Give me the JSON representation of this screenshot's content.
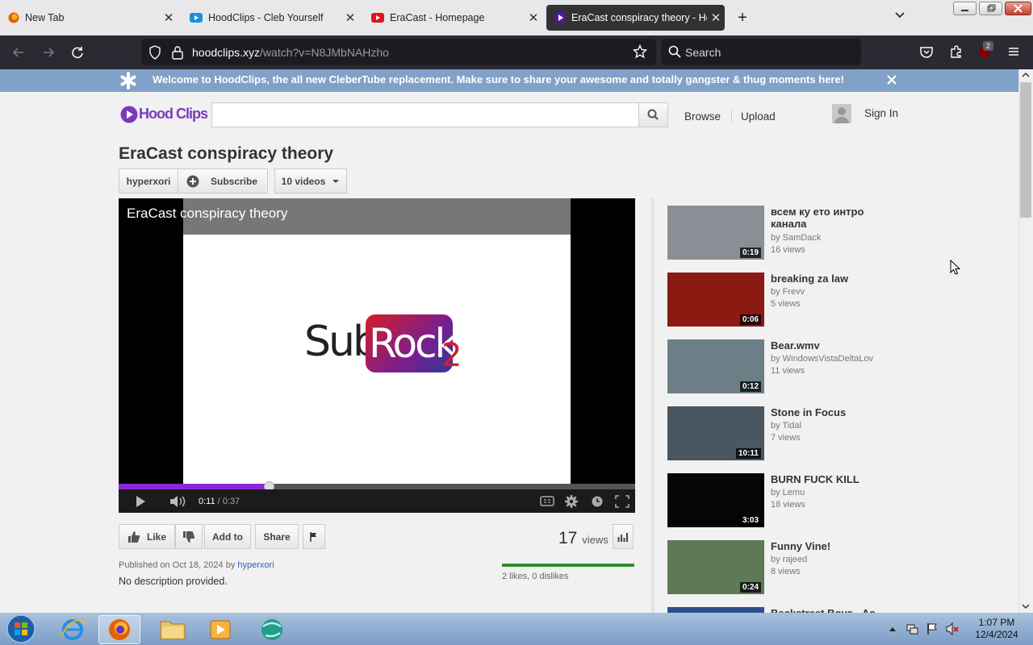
{
  "browser": {
    "tabs": [
      {
        "title": "New Tab",
        "icon": "firefox-icon",
        "active": false
      },
      {
        "title": "HoodClips - Cleb Yourself",
        "icon": "hoodclips-favicon",
        "active": false
      },
      {
        "title": "EraCast - Homepage",
        "icon": "eracast-favicon",
        "active": false
      },
      {
        "title": "EraCast conspiracy theory - Hoo",
        "icon": "hoodclips-play-favicon",
        "active": true
      }
    ],
    "url_host": "hoodclips.xyz",
    "url_path": "/watch?v=N8JMbNAHzho",
    "search_placeholder": "Search",
    "extension_badge": "2"
  },
  "banner": {
    "text": "Welcome to HoodClips, the all new CleberTube replacement. Make sure to share your awesome and totally gangster & thug moments here!"
  },
  "site": {
    "logo_text": "Hood Clips",
    "nav": {
      "browse": "Browse",
      "upload": "Upload",
      "signin": "Sign In"
    }
  },
  "video": {
    "title": "EraCast conspiracy theory",
    "channel": "hyperxori",
    "subscribe_label": "Subscribe",
    "videos_label": "10 videos",
    "overlay_title": "EraCast conspiracy theory",
    "current_time": "0:11",
    "total_time": "/ 0:37",
    "progress": 0.29,
    "logo_sub": "Sub",
    "logo_rock": "Rock",
    "logo_two": "2",
    "actions": {
      "like": "Like",
      "add_to": "Add to",
      "share": "Share"
    },
    "views_count": "17",
    "views_label": "views",
    "likes_text": "2 likes, 0 dislikes",
    "published_prefix": "Published on Oct 18, 2024 by",
    "published_by": "hyperxori",
    "description": "No description provided."
  },
  "sidebar": [
    {
      "title": "всем ку ето интро канала",
      "by": "by SamDack",
      "views": "16 views",
      "duration": "0:19",
      "color": "#8a8f96"
    },
    {
      "title": "breaking za law",
      "by": "by Frevv",
      "views": "5 views",
      "duration": "0:06",
      "color": "#8a1a12"
    },
    {
      "title": "Bear.wmv",
      "by": "by WindowsVistaDeltaLov",
      "views": "11 views",
      "duration": "0:12",
      "color": "#6c7f86"
    },
    {
      "title": "Stone in Focus",
      "by": "by Tidal",
      "views": "7 views",
      "duration": "10:11",
      "color": "#4a5660"
    },
    {
      "title": "BURN FUCK KILL",
      "by": "by Lemu",
      "views": "18 views",
      "duration": "3:03",
      "color": "#050505"
    },
    {
      "title": "Funny Vine!",
      "by": "by rajeed",
      "views": "8 views",
      "duration": "0:24",
      "color": "#5d7a55"
    },
    {
      "title": "Backstreet Boys - As",
      "by": "",
      "views": "",
      "duration": "",
      "color": "#2f4f8f"
    }
  ],
  "taskbar": {
    "time": "1:07 PM",
    "date": "12/4/2024"
  }
}
